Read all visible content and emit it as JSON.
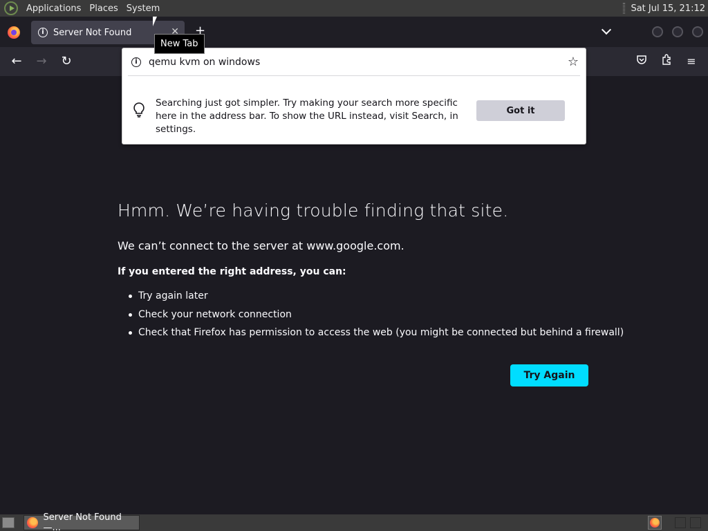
{
  "top_panel": {
    "menus": [
      "Applications",
      "Places",
      "System"
    ],
    "clock": "Sat Jul 15, 21:12"
  },
  "tabstrip": {
    "tab_title": "Server Not Found",
    "tooltip": "New Tab"
  },
  "urlbar": {
    "value": "qemu kvm on windows",
    "tip_text": "Searching just got simpler. Try making your search more specific here in the address bar. To show the URL instead, visit Search, in settings.",
    "got_it_label": "Got it"
  },
  "error_page": {
    "title": "Hmm. We’re having trouble finding that site.",
    "description": "We can’t connect to the server at www.google.com.",
    "subheading": "If you entered the right address, you can:",
    "suggestions": [
      "Try again later",
      "Check your network connection",
      "Check that Firefox has permission to access the web (you might be connected but behind a firewall)"
    ],
    "try_again_label": "Try Again"
  },
  "taskbar": {
    "task_label": "Server Not Found —..."
  },
  "colors": {
    "page_bg": "#1c1b22",
    "accent": "#00ddff",
    "toolbar": "#2b2a33",
    "tab": "#42414d"
  },
  "icons": [
    "firefox-icon",
    "info-icon",
    "close-icon",
    "plus-icon",
    "chevron-down-icon",
    "back-icon",
    "forward-icon",
    "reload-icon",
    "star-icon",
    "pocket-icon",
    "extensions-icon",
    "hamburger-menu-icon",
    "lightbulb-icon"
  ]
}
